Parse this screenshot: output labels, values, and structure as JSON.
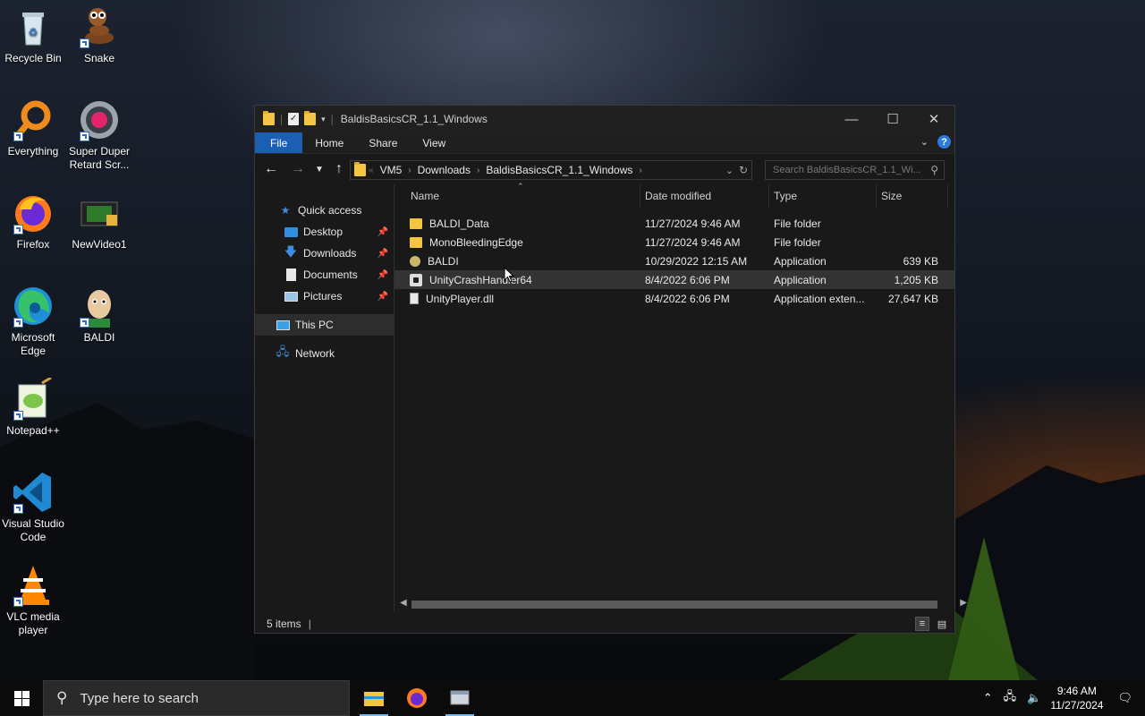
{
  "desktop": {
    "icons": [
      {
        "label": "Recycle Bin",
        "icon": "recycle-bin-icon"
      },
      {
        "label": "Snake",
        "icon": "snake-icon"
      },
      {
        "label": "Everything",
        "icon": "everything-search-icon"
      },
      {
        "label": "Super Duper Retard Scr...",
        "icon": "record-button-icon"
      },
      {
        "label": "Firefox",
        "icon": "firefox-icon"
      },
      {
        "label": "NewVideo1",
        "icon": "video-file-icon"
      },
      {
        "label": "Microsoft Edge",
        "icon": "edge-icon"
      },
      {
        "label": "BALDI",
        "icon": "baldi-icon"
      },
      {
        "label": "Notepad++",
        "icon": "notepadpp-icon"
      },
      {
        "label": "Visual Studio Code",
        "icon": "vscode-icon"
      },
      {
        "label": "VLC media player",
        "icon": "vlc-icon"
      }
    ]
  },
  "window": {
    "title": "BaldisBasicsCR_1.1_Windows",
    "ribbon_tabs": [
      "File",
      "Home",
      "Share",
      "View"
    ],
    "address": {
      "crumbs": [
        "VM5",
        "Downloads",
        "BaldisBasicsCR_1.1_Windows"
      ]
    },
    "search_placeholder": "Search BaldisBasicsCR_1.1_Wi...",
    "nav": {
      "quick_access": "Quick access",
      "items": [
        {
          "label": "Desktop",
          "icon": "desktop-icon"
        },
        {
          "label": "Downloads",
          "icon": "downloads-icon"
        },
        {
          "label": "Documents",
          "icon": "documents-icon"
        },
        {
          "label": "Pictures",
          "icon": "pictures-icon"
        }
      ],
      "this_pc": "This PC",
      "network": "Network"
    },
    "columns": {
      "name": "Name",
      "date": "Date modified",
      "type": "Type",
      "size": "Size"
    },
    "files": [
      {
        "name": "BALDI_Data",
        "date": "11/27/2024 9:46 AM",
        "type": "File folder",
        "size": "",
        "icon": "folder"
      },
      {
        "name": "MonoBleedingEdge",
        "date": "11/27/2024 9:46 AM",
        "type": "File folder",
        "size": "",
        "icon": "folder"
      },
      {
        "name": "BALDI",
        "date": "10/29/2022 12:15 AM",
        "type": "Application",
        "size": "639 KB",
        "icon": "app"
      },
      {
        "name": "UnityCrashHandler64",
        "date": "8/4/2022 6:06 PM",
        "type": "Application",
        "size": "1,205 KB",
        "icon": "unity"
      },
      {
        "name": "UnityPlayer.dll",
        "date": "8/4/2022 6:06 PM",
        "type": "Application exten...",
        "size": "27,647 KB",
        "icon": "dll"
      }
    ],
    "status": "5 items"
  },
  "taskbar": {
    "search_placeholder": "Type here to search",
    "time": "9:46 AM",
    "date": "11/27/2024"
  }
}
